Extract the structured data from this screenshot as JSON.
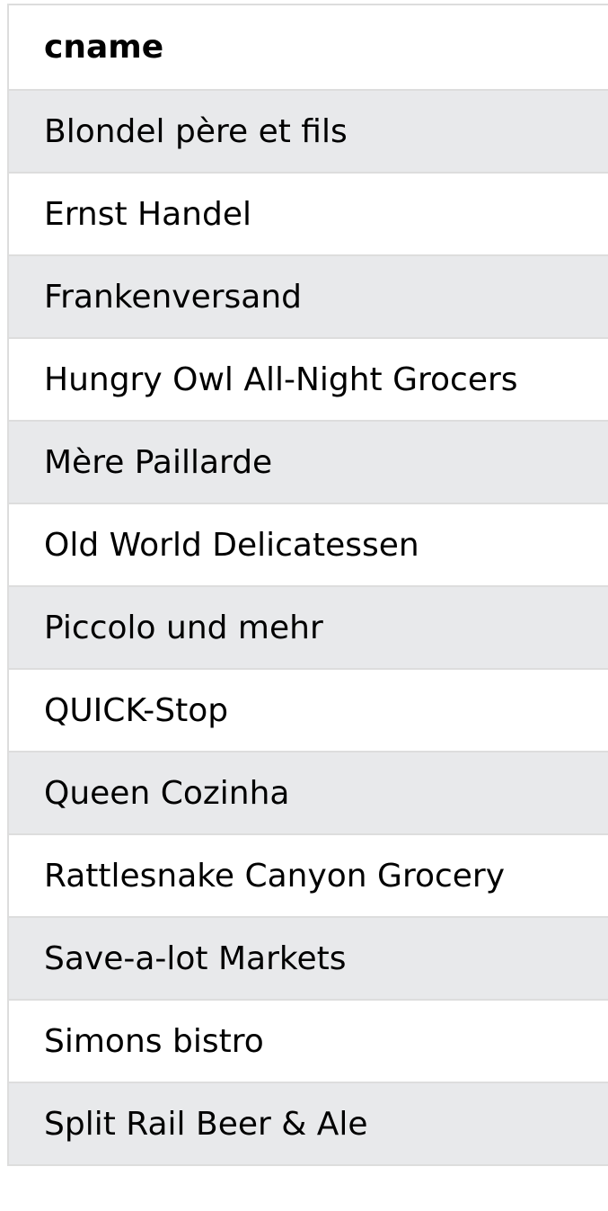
{
  "table": {
    "column_header": "cname",
    "rows": [
      "Blondel père et fils",
      "Ernst Handel",
      "Frankenversand",
      "Hungry Owl All-Night Grocers",
      "Mère Paillarde",
      "Old World Delicatessen",
      "Piccolo und mehr",
      "QUICK-Stop",
      "Queen Cozinha",
      "Rattlesnake Canyon Grocery",
      "Save-a-lot Markets",
      "Simons bistro",
      "Split Rail Beer & Ale"
    ]
  },
  "colors": {
    "stripe": "#e8e9eb",
    "border": "#dddddd",
    "background": "#ffffff"
  }
}
